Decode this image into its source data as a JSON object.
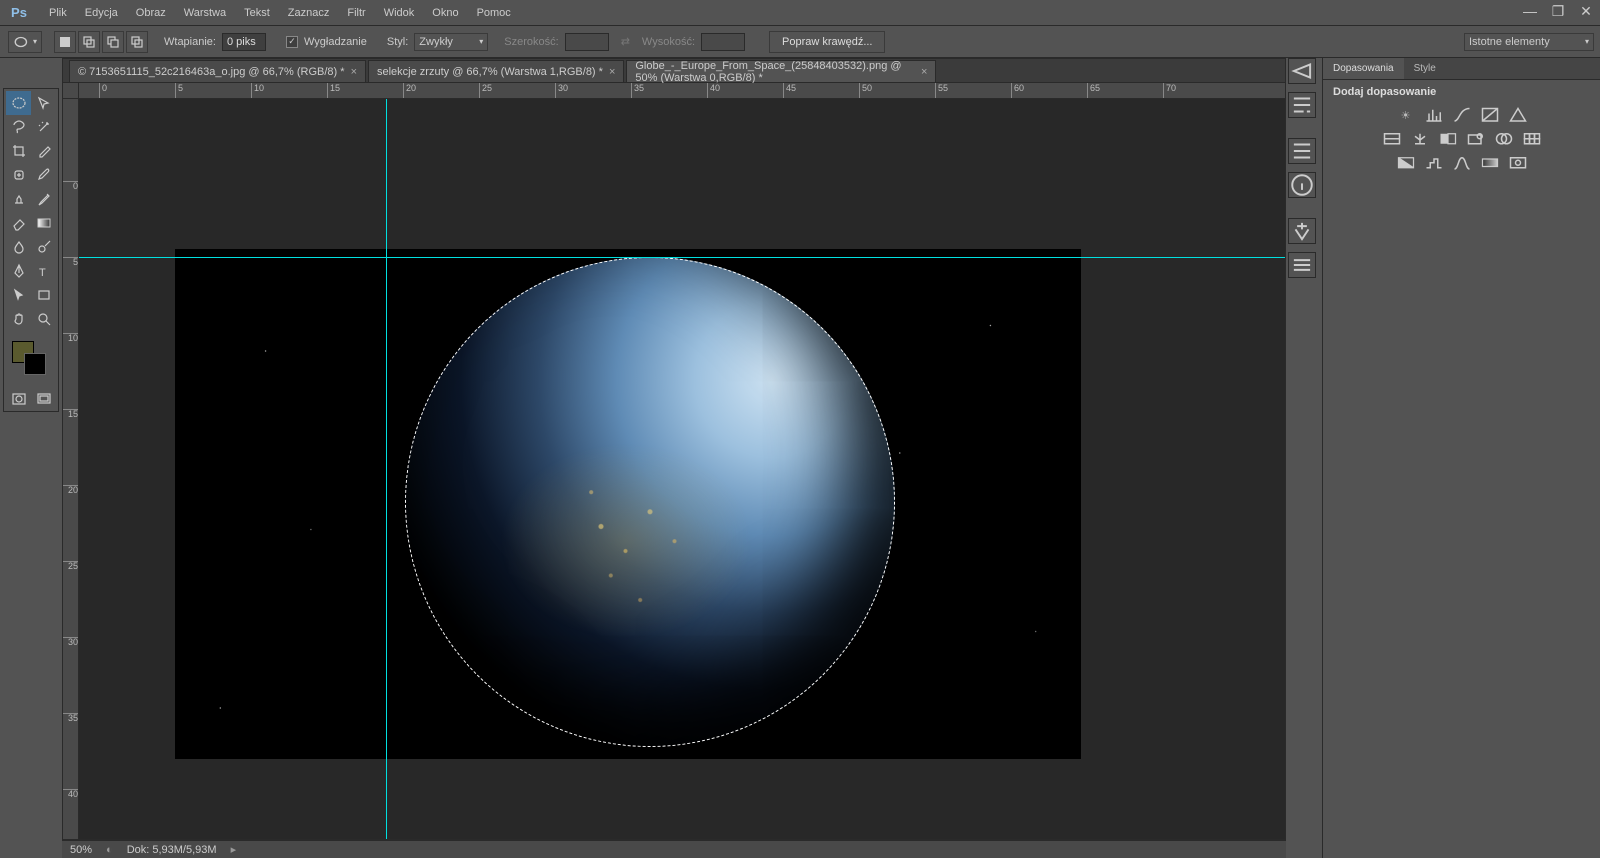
{
  "app": {
    "logo": "Ps"
  },
  "menu": [
    "Plik",
    "Edycja",
    "Obraz",
    "Warstwa",
    "Tekst",
    "Zaznacz",
    "Filtr",
    "Widok",
    "Okno",
    "Pomoc"
  ],
  "options": {
    "wtapianie_label": "Wtapianie:",
    "wtapianie_value": "0 piks",
    "wygladzanie_label": "Wygładzanie",
    "styl_label": "Styl:",
    "styl_value": "Zwykły",
    "szerokosc_label": "Szerokość:",
    "wysokosc_label": "Wysokość:",
    "popraw_button": "Popraw krawędź...",
    "right_select": "Istotne elementy"
  },
  "tabs": [
    {
      "label": "© 7153651115_52c216463a_o.jpg @ 66,7% (RGB/8) *",
      "active": false
    },
    {
      "label": "selekcje zrzuty @ 66,7% (Warstwa 1,RGB/8) *",
      "active": false
    },
    {
      "label": "Globe_-_Europe_From_Space_(25848403532).png @ 50% (Warstwa 0,RGB/8) *",
      "active": true
    }
  ],
  "ruler_h": [
    0,
    5,
    10,
    15,
    20,
    25,
    30,
    35,
    40,
    45,
    50,
    55,
    60,
    65,
    70
  ],
  "ruler_v": [
    0,
    5,
    10,
    15,
    20,
    25,
    30,
    35,
    40
  ],
  "status": {
    "zoom": "50%",
    "doc": "Dok: 5,93M/5,93M"
  },
  "right_panel": {
    "tab_dopasowania": "Dopasowania",
    "tab_style": "Style",
    "heading": "Dodaj dopasowanie"
  },
  "colors": {
    "fg": "#5a5a2e",
    "bg": "#000000",
    "guide": "#00e0e0"
  }
}
